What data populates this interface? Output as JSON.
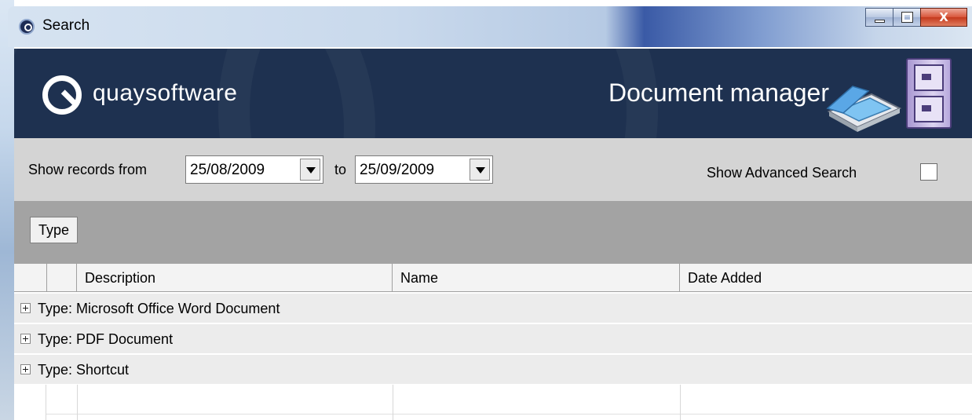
{
  "window": {
    "title": "Search",
    "controls": {
      "minimize": "",
      "maximize": "",
      "close": "X"
    }
  },
  "header": {
    "logo_text": "quaysoftware",
    "app_title": "Document manager",
    "colors": {
      "background": "#1e3150",
      "text": "#ffffff"
    }
  },
  "filters": {
    "from_label": "Show records from",
    "from_date": "25/08/2009",
    "to_label": "to",
    "to_date": "25/09/2009",
    "advanced_label": "Show Advanced Search",
    "advanced_checked": false
  },
  "grouping": {
    "group_by": [
      "Type"
    ]
  },
  "grid": {
    "columns": [
      "Description",
      "Name",
      "Date Added"
    ],
    "groups": [
      {
        "label": "Type: Microsoft Office Word Document",
        "expanded": false
      },
      {
        "label": "Type: PDF Document",
        "expanded": false
      },
      {
        "label": "Type: Shortcut",
        "expanded": false
      }
    ]
  }
}
